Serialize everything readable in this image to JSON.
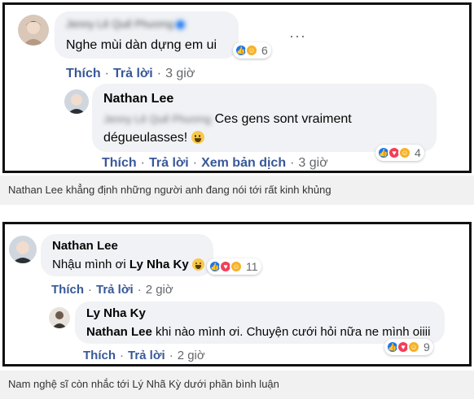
{
  "screenshot1": {
    "comment": {
      "author": "Jenny Lê Quế Phương",
      "text": "Nghe mùi dàn dựng em ui",
      "reactions": {
        "icons": [
          "like-icon",
          "haha-icon"
        ],
        "count": "6"
      },
      "more": "···",
      "actions": {
        "like": "Thích",
        "reply": "Trả lời",
        "time": "3 giờ"
      }
    },
    "reply": {
      "author": "Nathan Lee",
      "mention": "Jenny Lê Quế Phương",
      "text_line1": "Ces gens sont vraiment",
      "text_line2": "dégueulasses!",
      "reactions": {
        "icons": [
          "like-icon",
          "love-icon",
          "haha-icon"
        ],
        "count": "4"
      },
      "actions": {
        "like": "Thích",
        "reply": "Trả lời",
        "translate": "Xem bản dịch",
        "time": "3 giờ"
      }
    },
    "caption": "Nathan Lee khẳng định những người anh đang nói tới rất kinh khủng"
  },
  "screenshot2": {
    "comment": {
      "author": "Nathan Lee",
      "text": "Nhậu mình ơi",
      "mention": "Ly Nha Ky",
      "reactions": {
        "icons": [
          "like-icon",
          "love-icon",
          "haha-icon"
        ],
        "count": "11"
      },
      "actions": {
        "like": "Thích",
        "reply": "Trả lời",
        "time": "2 giờ"
      }
    },
    "reply": {
      "author": "Ly Nha Ky",
      "mention": "Nathan Lee",
      "text": "khi nào mình ơi. Chuyện cưới hỏi nữa ne mình oiiii",
      "reactions": {
        "icons": [
          "like-icon",
          "love-icon",
          "haha-icon"
        ],
        "count": "9"
      },
      "actions": {
        "like": "Thích",
        "reply": "Trả lời",
        "time": "2 giờ"
      }
    },
    "caption": "Nam nghệ sĩ còn nhắc tới Lý Nhã Kỳ dưới phần bình luận"
  },
  "colors": {
    "link": "#385898",
    "meta": "#65676b",
    "bubble": "#f0f2f5",
    "like": "#1877f2",
    "love": "#f33e58",
    "haha": "#f7b125"
  }
}
